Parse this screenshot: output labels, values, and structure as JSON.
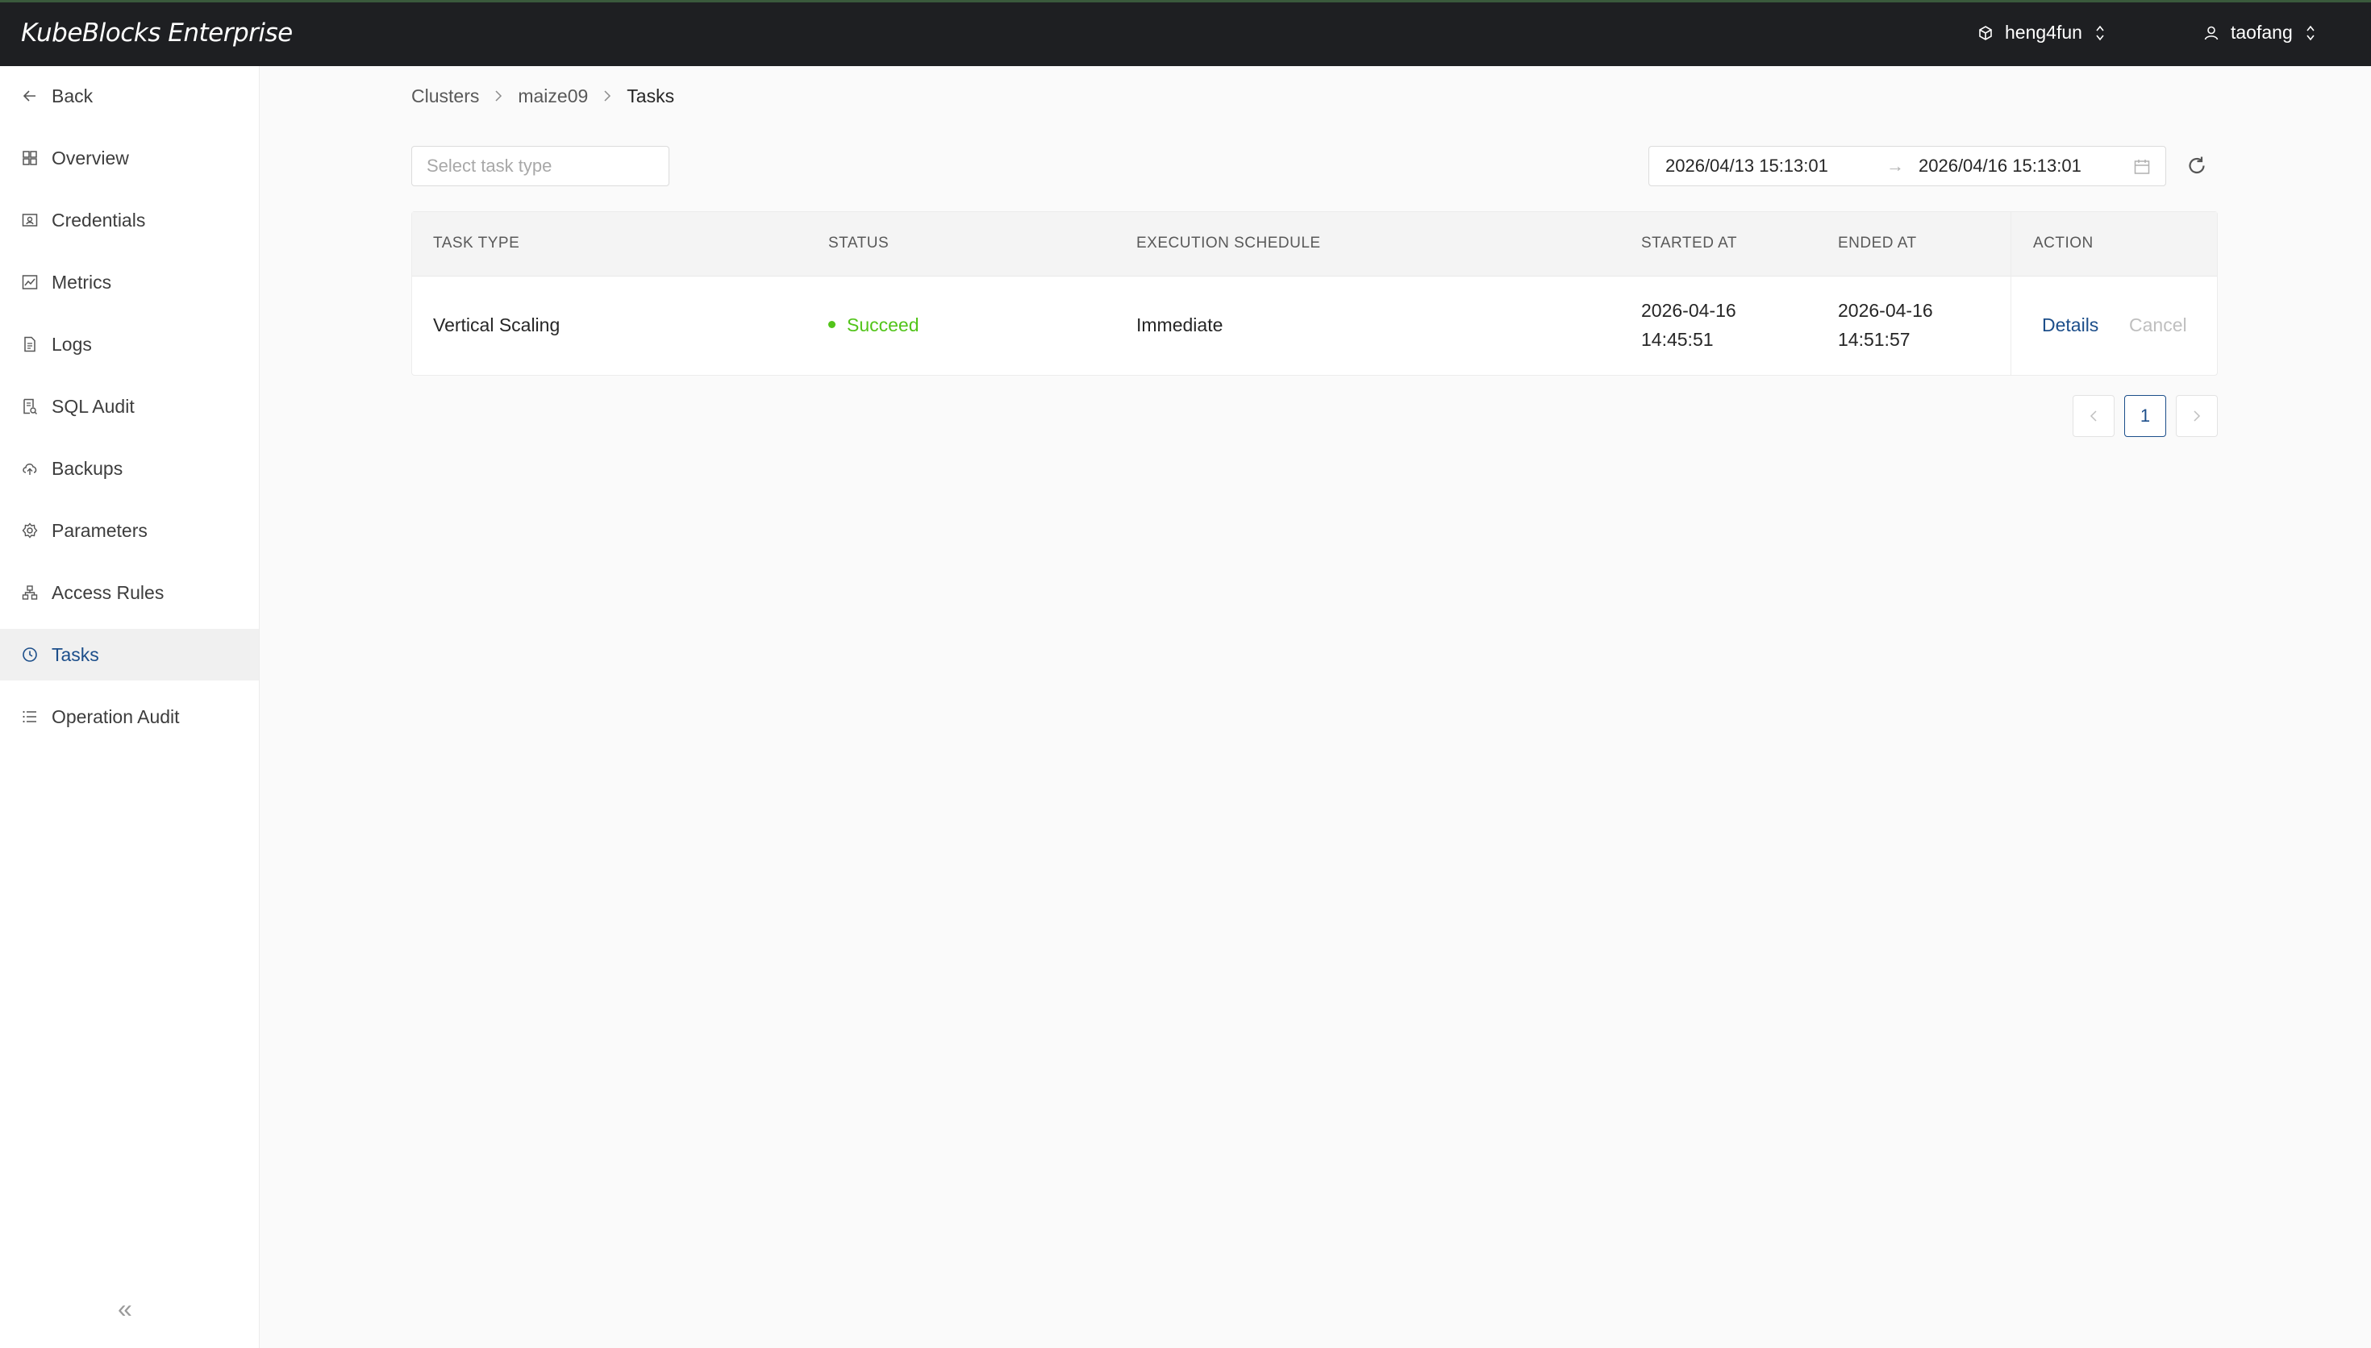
{
  "app": {
    "title": "KubeBlocks Enterprise"
  },
  "header": {
    "org": "heng4fun",
    "user": "taofang"
  },
  "sidebar": {
    "items": [
      {
        "label": "Back",
        "icon": "arrow-left-icon"
      },
      {
        "label": "Overview",
        "icon": "grid-icon"
      },
      {
        "label": "Credentials",
        "icon": "key-card-icon"
      },
      {
        "label": "Metrics",
        "icon": "chart-icon"
      },
      {
        "label": "Logs",
        "icon": "document-icon"
      },
      {
        "label": "SQL Audit",
        "icon": "audit-icon"
      },
      {
        "label": "Backups",
        "icon": "cloud-upload-icon"
      },
      {
        "label": "Parameters",
        "icon": "gear-icon"
      },
      {
        "label": "Access Rules",
        "icon": "network-icon"
      },
      {
        "label": "Tasks",
        "icon": "clock-icon"
      },
      {
        "label": "Operation Audit",
        "icon": "list-icon"
      }
    ],
    "active": "Tasks",
    "collapse_glyph": "«"
  },
  "breadcrumb": [
    "Clusters",
    "maize09",
    "Tasks"
  ],
  "filters": {
    "task_type_placeholder": "Select task type",
    "start": "2026/04/13 15:13:01",
    "end": "2026/04/16 15:13:01",
    "arrow": "→"
  },
  "table": {
    "columns": [
      "TASK TYPE",
      "STATUS",
      "EXECUTION SCHEDULE",
      "STARTED AT",
      "ENDED AT",
      "ACTION"
    ],
    "rows": [
      {
        "task_type": "Vertical Scaling",
        "status": "Succeed",
        "schedule": "Immediate",
        "started_date": "2026-04-16",
        "started_time": "14:45:51",
        "ended_date": "2026-04-16",
        "ended_time": "14:51:57",
        "action_details": "Details",
        "action_cancel": "Cancel"
      }
    ]
  },
  "pagination": {
    "current": "1",
    "prev": "‹",
    "next": "›"
  },
  "colors": {
    "accent": "#1c4e8a",
    "success": "#52c41a",
    "header_bg": "#1e1f22"
  }
}
